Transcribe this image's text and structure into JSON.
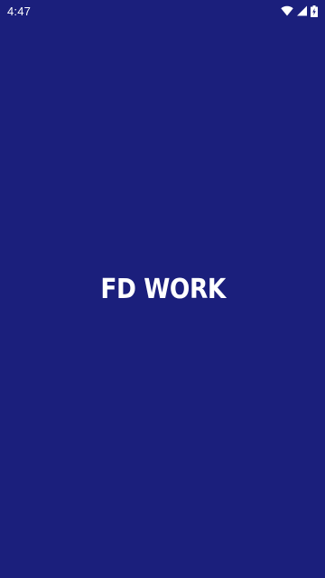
{
  "status_bar": {
    "time": "4:47",
    "icons": [
      "wifi-icon",
      "cell-signal-icon",
      "battery-charging-icon"
    ]
  },
  "splash": {
    "app_name": "FD WORK"
  },
  "colors": {
    "background": "#1b1f7c",
    "foreground": "#ffffff"
  }
}
